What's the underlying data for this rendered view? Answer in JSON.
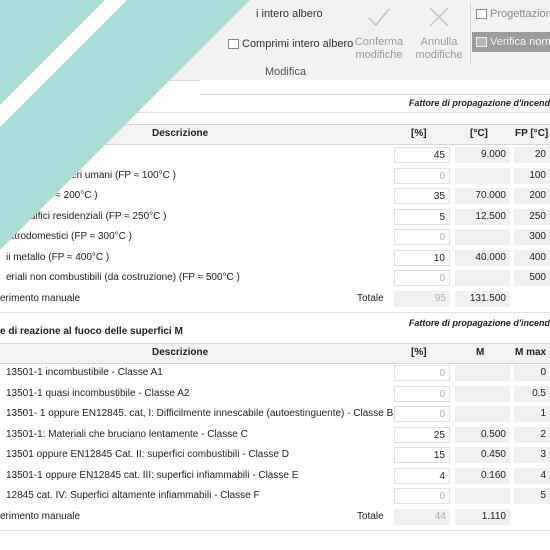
{
  "ribbon": {
    "tree_top": "i intero albero",
    "tree_collapse": "Comprimi intero albero",
    "confirm": [
      "Conferma",
      "modifiche"
    ],
    "cancel": [
      "Annulla",
      "modifiche"
    ],
    "progettazione": "Progettazion",
    "verifica": "Verifica norm",
    "group": "Modifica"
  },
  "fp": {
    "section_head": "Fattore di propagazione d'incend",
    "columns": {
      "desc": "Descrizione",
      "pct": "[%]",
      "temp": "[°C]",
      "fp": "FP [°C]"
    },
    "rows": [
      {
        "desc": ")",
        "pct": "45",
        "pct_muted": false,
        "temp": "9.000",
        "fp": "20"
      },
      {
        "desc": "ettroniche, esseri umani   (FP ≈ 100°C )",
        "pct": "0",
        "pct_muted": true,
        "temp": "",
        "fp": "100"
      },
      {
        "desc": "mento  (FP ≈ 200°C )",
        "pct": "35",
        "pct_muted": false,
        "temp": "70.000",
        "fp": "200"
      },
      {
        "desc": "egli edifici residenziali  (FP ≈ 250°C )",
        "pct": "5",
        "pct_muted": false,
        "temp": "12.500",
        "fp": "250"
      },
      {
        "desc": "ettrodomestici (FP ≈ 300°C )",
        "pct": "0",
        "pct_muted": true,
        "temp": "",
        "fp": "300"
      },
      {
        "desc": "ii metallo (FP ≈ 400°C )",
        "pct": "10",
        "pct_muted": false,
        "temp": "40.000",
        "fp": "400"
      },
      {
        "desc": "eriali non combustibili (da costruzione) (FP ≈ 500°C )",
        "pct": "0",
        "pct_muted": true,
        "temp": "",
        "fp": "500"
      }
    ],
    "total": {
      "desc": "erimento manuale",
      "label": "Totale",
      "pct": "95",
      "value": "131.500"
    }
  },
  "m": {
    "section_head": "Fattore di propagazione d'incend",
    "title": "e di reazione al fuoco delle superfici  M",
    "columns": {
      "desc": "Descrizione",
      "pct": "[%]",
      "m": "M",
      "mmax": "M max"
    },
    "rows": [
      {
        "desc": "13501-1  incombustibile - Classe A1",
        "pct": "0",
        "pct_muted": true,
        "m": "",
        "mmax": "0"
      },
      {
        "desc": "13501-1  quasi incombustibile - Classe A2",
        "pct": "0",
        "pct_muted": true,
        "m": "",
        "mmax": "0.5"
      },
      {
        "desc": "13501- 1 oppure EN12845. cat, I: Difficilmente innescabile (autoestinguente) - Classe B",
        "pct": "0",
        "pct_muted": true,
        "m": "",
        "mmax": "1"
      },
      {
        "desc": "13501-1: Materiali che bruciano lentamente - Classe C",
        "pct": "25",
        "pct_muted": false,
        "m": "0.500",
        "mmax": "2"
      },
      {
        "desc": "13501 oppure EN12845 Cat. II: superfici combustibili - Classe D",
        "pct": "15",
        "pct_muted": false,
        "m": "0.450",
        "mmax": "3"
      },
      {
        "desc": "13501-1 oppure EN12845 cat. III: superfici infiammabili - Classe E",
        "pct": "4",
        "pct_muted": false,
        "m": "0.160",
        "mmax": "4"
      },
      {
        "desc": "12845 cat. IV: Superfici altamente infiammabili - Classe F",
        "pct": "0",
        "pct_muted": true,
        "m": "",
        "mmax": "5"
      }
    ],
    "total": {
      "desc": "erimento manuale",
      "label": "Totale",
      "pct": "44",
      "value": "1.110"
    }
  },
  "colors": {
    "teal_overlay": "#a9ddd8"
  }
}
